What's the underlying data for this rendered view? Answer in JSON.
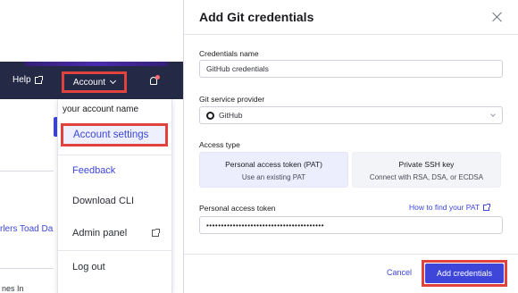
{
  "topbar": {
    "help_label": "Help",
    "account_label": "Account"
  },
  "dropdown": {
    "account_name": "your account name",
    "items": [
      {
        "label": "Account settings"
      },
      {
        "label": "Feedback"
      },
      {
        "label": "Download CLI"
      },
      {
        "label": "Admin panel"
      },
      {
        "label": "Log out"
      }
    ]
  },
  "background": {
    "project_link": "rlers Toad Da",
    "cut_text": "nes In"
  },
  "modal": {
    "title": "Add Git credentials",
    "credentials_name": {
      "label": "Credentials name",
      "value": "GitHub credentials"
    },
    "provider": {
      "label": "Git service provider",
      "value": "GitHub"
    },
    "access_type": {
      "label": "Access type",
      "options": [
        {
          "title": "Personal access token (PAT)",
          "subtitle": "Use an existing PAT",
          "selected": true
        },
        {
          "title": "Private SSH key",
          "subtitle": "Connect with RSA, DSA, or ECDSA",
          "selected": false
        }
      ]
    },
    "token": {
      "label": "Personal access token",
      "help_link": "How to find your PAT",
      "value": "••••••••••••••••••••••••••••••••••••••••"
    },
    "cancel_label": "Cancel",
    "submit_label": "Add credentials"
  },
  "colors": {
    "accent": "#3d46d8",
    "topbar": "#242a45",
    "highlight_outline": "#e0433e"
  }
}
